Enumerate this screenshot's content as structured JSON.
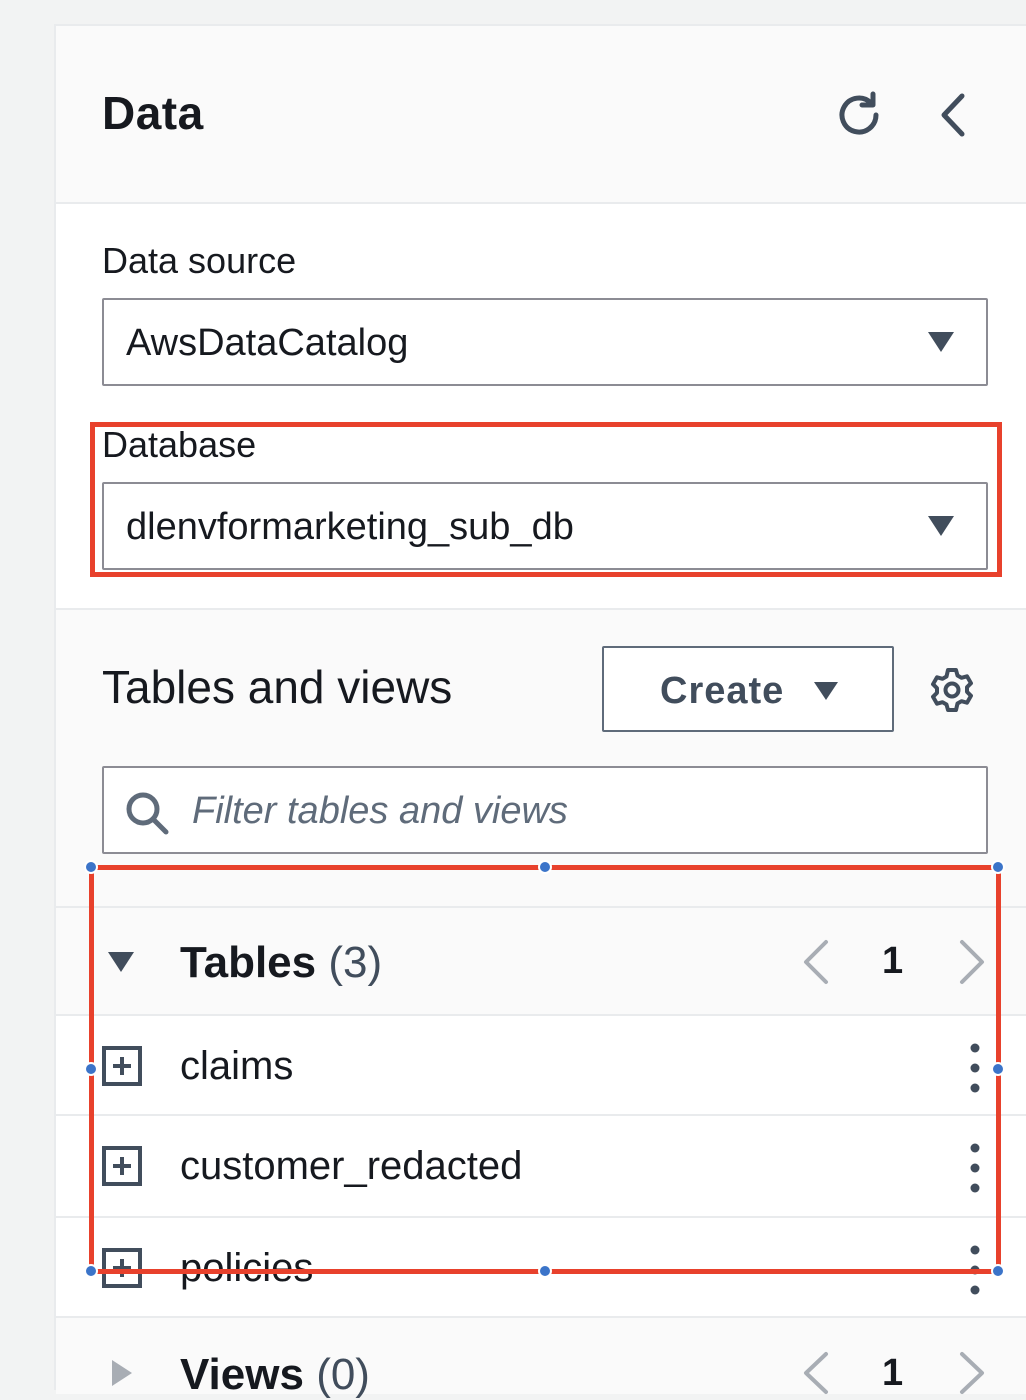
{
  "header": {
    "title": "Data"
  },
  "data_source": {
    "label": "Data source",
    "value": "AwsDataCatalog"
  },
  "database": {
    "label": "Database",
    "value": "dlenvformarketing_sub_db"
  },
  "tables_views": {
    "title": "Tables and views",
    "create_label": "Create",
    "filter_placeholder": "Filter tables and views"
  },
  "tables_group": {
    "name": "Tables",
    "count": "(3)",
    "page": "1",
    "expanded": true,
    "items": [
      {
        "name": "claims"
      },
      {
        "name": "customer_redacted"
      },
      {
        "name": "policies"
      }
    ]
  },
  "views_group": {
    "name": "Views",
    "count": "(0)",
    "page": "1",
    "expanded": false
  },
  "colors": {
    "highlight": "#e8412c",
    "handle": "#3b74c9",
    "text": "#16191f",
    "muted": "#5f6b7a"
  },
  "icons": {
    "refresh": "refresh-icon",
    "collapse": "chevron-left-icon",
    "caret": "caret-down-icon",
    "settings": "gear-icon",
    "search": "search-icon",
    "expand_row": "plus-square-icon",
    "actions": "vertical-ellipsis-icon"
  }
}
